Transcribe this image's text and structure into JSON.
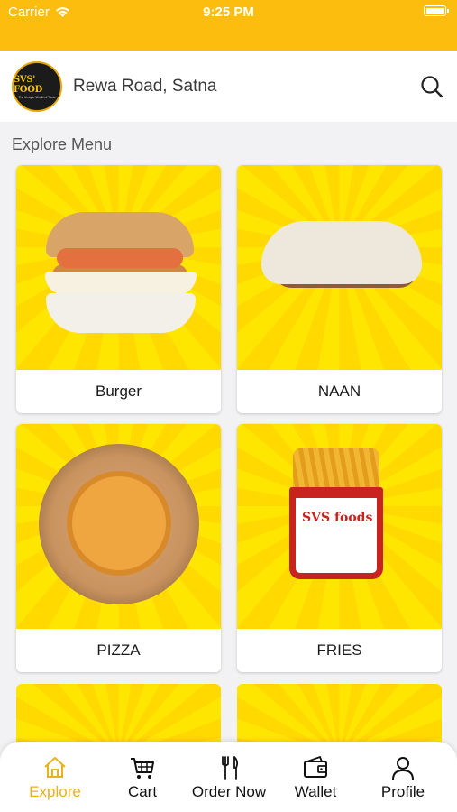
{
  "status_bar": {
    "carrier": "Carrier",
    "time": "9:25 PM"
  },
  "header": {
    "logo_text": "SVS' FOOD",
    "logo_tagline": "The Unique World of Taste",
    "location": "Rewa Road, Satna",
    "search_icon": "search-icon"
  },
  "section_title": "Explore Menu",
  "menu_items": [
    {
      "label": "Burger"
    },
    {
      "label": "NAAN"
    },
    {
      "label": "PIZZA"
    },
    {
      "label": "FRIES"
    }
  ],
  "fries_brand": "SVS foods",
  "tabs": [
    {
      "label": "Explore",
      "icon": "home-icon",
      "active": true
    },
    {
      "label": "Cart",
      "icon": "cart-icon",
      "active": false
    },
    {
      "label": "Order Now",
      "icon": "fork-knife-icon",
      "active": false
    },
    {
      "label": "Wallet",
      "icon": "wallet-icon",
      "active": false
    },
    {
      "label": "Profile",
      "icon": "profile-icon",
      "active": false
    }
  ],
  "colors": {
    "accent": "#fdbd0f",
    "active_tab": "#e8b21b",
    "card_bg": "#ffe600"
  }
}
